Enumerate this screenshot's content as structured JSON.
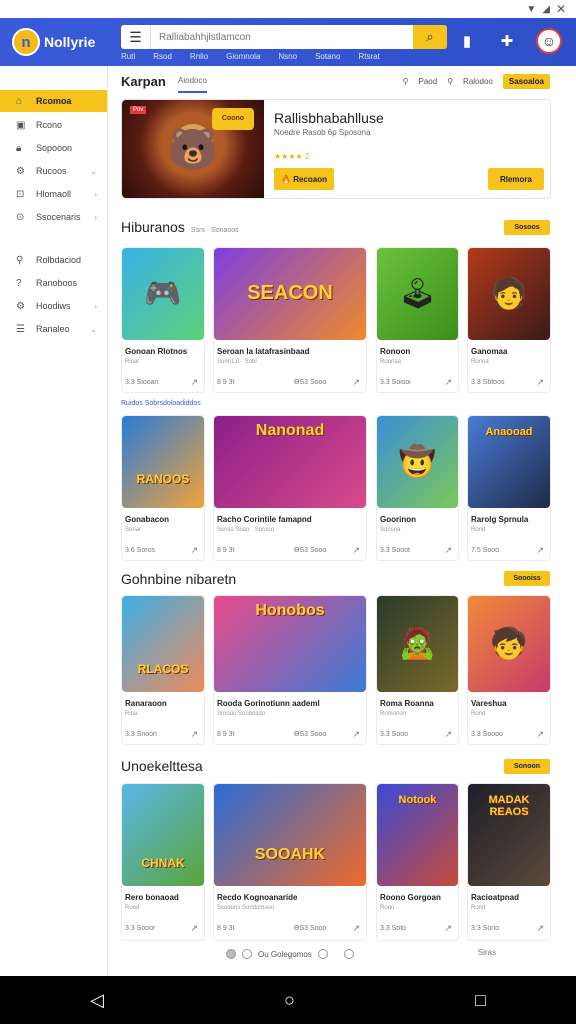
{
  "app": {
    "name": "Nollyrie"
  },
  "search": {
    "placeholder": "Ralliabahhjlstlamcon"
  },
  "subnav": [
    "Ruti",
    "Rsod",
    "Rnlio",
    "Giomnola",
    "Nsno",
    "Sotano",
    "Rtsrat"
  ],
  "sidebar": {
    "items": [
      {
        "label": "Rcomoa",
        "icon": "home-icon",
        "active": true,
        "chev": false
      },
      {
        "label": "Rcono",
        "icon": "grid-icon",
        "chev": false
      },
      {
        "label": "Sopooon",
        "icon": "lock-icon",
        "chev": false
      },
      {
        "label": "Rucoos",
        "icon": "gear-icon",
        "chev": true
      },
      {
        "label": "Hlomaoll",
        "icon": "cart-icon",
        "chev": true
      },
      {
        "label": "Ssocenaris",
        "icon": "circle-icon",
        "chev": true
      }
    ],
    "items2": [
      {
        "label": "Rolbdaciod",
        "icon": "user-icon",
        "chev": false
      },
      {
        "label": "Ranoboos",
        "icon": "help-icon",
        "chev": false
      },
      {
        "label": "Hoodiws",
        "icon": "settings-icon",
        "chev": true
      },
      {
        "label": "Ranaleo",
        "icon": "list-icon",
        "chev": true
      }
    ]
  },
  "header": {
    "title": "Karpan",
    "tab": "Aiodoco",
    "links": [
      "Paod",
      "Ralodoo"
    ],
    "button": "Sasoaloa"
  },
  "featured": {
    "badge": "Pov",
    "image_text": "Coono",
    "title": "Rallisbhabahlluse",
    "subtitle": "Noedre Rasob 6p Sposona",
    "rating": "★★★★ 2",
    "btn_primary": "🔥 Recoaon",
    "btn_secondary": "Rlemora"
  },
  "sections": [
    {
      "title": "Hiburanos",
      "tag": "Ssrs · Sonaoos",
      "button": "Sosoos",
      "sublabel": "Ruidos Sobrsdoloadiddos"
    },
    {
      "title": "Gohnbine nibaretn",
      "button": "Soooiss"
    },
    {
      "title": "Unoekelttesa",
      "button": "Sonoon"
    }
  ],
  "cards": [
    {
      "title": "Gonoan Rlotnos",
      "sub": "Rinal",
      "meta": "3.3 Siooan"
    },
    {
      "title": "Seroan la latafrasinbaad",
      "sub": "Sonn1.0 · Sobl",
      "meta": "8 9 3t",
      "meta2": "ƟS3 Sooo",
      "wordart": "SEACON"
    },
    {
      "title": "Ronoon",
      "sub": "Ronnaa",
      "meta": "3.3 Soisoi"
    },
    {
      "title": "Ganomaa",
      "sub": "Ronna",
      "meta": "3.3 Sbtoos"
    },
    {
      "title": "Gonabacon",
      "sub": "Sonar",
      "meta": "3.6 Soros",
      "wordart": "RANOOS"
    },
    {
      "title": "Racho Corintile famapnd",
      "sub": "Ssnso Snao · Sorooo",
      "meta": "8 9 3t",
      "meta2": "ƟS3 Sooo",
      "wordart": "Nanonad"
    },
    {
      "title": "Goorinon",
      "sub": "Sonsna",
      "meta": "3.3 Sooot"
    },
    {
      "title": "Rarolg Sprnula",
      "sub": "Rond",
      "meta": "7.5 Sooo",
      "wordart": "Anaooad"
    },
    {
      "title": "Ranaraoon",
      "sub": "Rina",
      "meta": "3.3 Snoon",
      "wordart": "RLACOS"
    },
    {
      "title": "Rooda Gorinotiunn aademl",
      "sub": "Srnodo Sonbosdo",
      "meta": "8 9 3t",
      "meta2": "ƟS3 Sooo",
      "wordart": "Honobos"
    },
    {
      "title": "Roma Roanna",
      "sub": "Romonorr",
      "meta": "3.3 Sooo"
    },
    {
      "title": "Vareshua",
      "sub": "Rond",
      "meta": "3.3 Soooo"
    },
    {
      "title": "Rero bonaoad",
      "sub": "Rond",
      "meta": "3.3 Sooor",
      "wordart": "CHNAK"
    },
    {
      "title": "Recdo Kognoanaride",
      "sub": "Scodons Sondomaso",
      "meta": "8 9 3t",
      "meta2": "ƟS3 Sooo",
      "wordart": "SOOAHK"
    },
    {
      "title": "Roono Gorgoan",
      "sub": "Ronn",
      "meta": "3.3 Soto",
      "wordart": "Notook"
    },
    {
      "title": "Racioatpnad",
      "sub": "Rond",
      "meta": "3.3 Sorio",
      "wordart": "MADAK REAOS"
    }
  ],
  "pager": {
    "label": "Ou Golegomos",
    "end": "Siras"
  }
}
